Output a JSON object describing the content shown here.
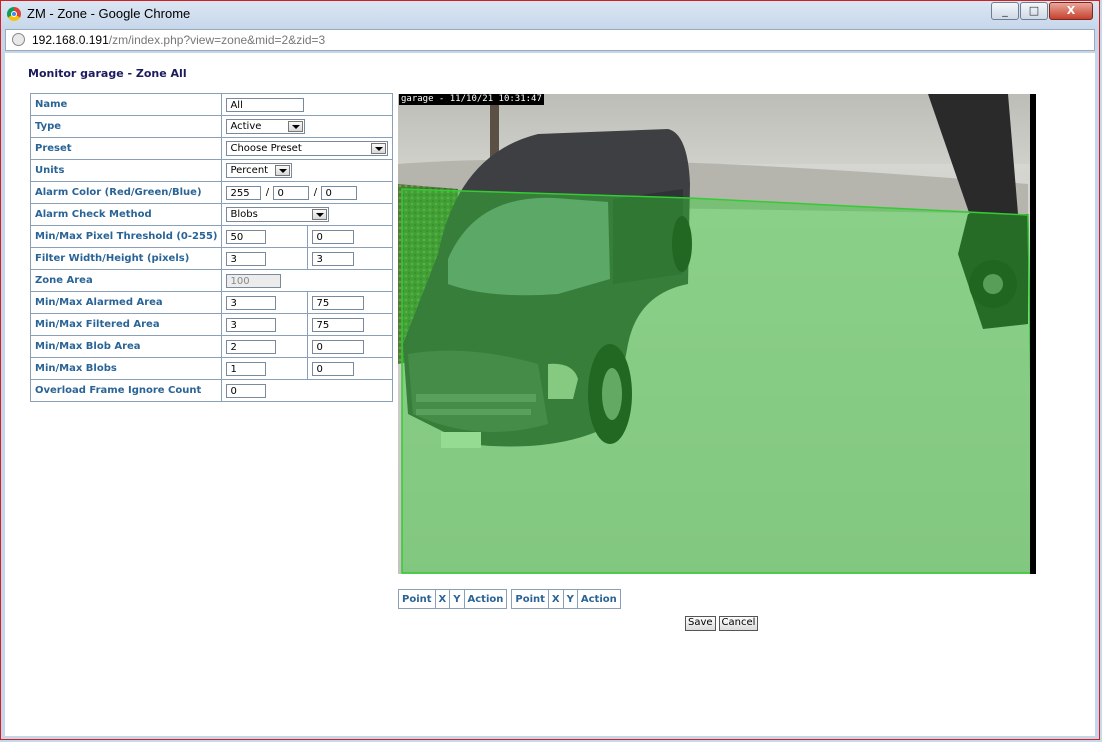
{
  "window": {
    "title": "ZM - Zone - Google Chrome",
    "minimize": "_",
    "maximize": "□",
    "close": "X"
  },
  "address": {
    "host": "192.168.0.191",
    "path": "/zm/index.php?view=zone&mid=2&zid=3"
  },
  "page": {
    "title": "Monitor garage - Zone All"
  },
  "form": {
    "name": {
      "label": "Name",
      "value": "All"
    },
    "type": {
      "label": "Type",
      "value": "Active"
    },
    "preset": {
      "label": "Preset",
      "value": "Choose Preset"
    },
    "units": {
      "label": "Units",
      "value": "Percent"
    },
    "alarm_color": {
      "label": "Alarm Color (Red/Green/Blue)",
      "red": "255",
      "green": "0",
      "blue": "0",
      "sep": "/"
    },
    "check_method": {
      "label": "Alarm Check Method",
      "value": "Blobs"
    },
    "pixel_threshold": {
      "label": "Min/Max Pixel Threshold (0-255)",
      "min": "50",
      "max": "0"
    },
    "filter_size": {
      "label": "Filter Width/Height (pixels)",
      "width": "3",
      "height": "3"
    },
    "zone_area": {
      "label": "Zone Area",
      "value": "100"
    },
    "alarmed_area": {
      "label": "Min/Max Alarmed Area",
      "min": "3",
      "max": "75"
    },
    "filtered_area": {
      "label": "Min/Max Filtered Area",
      "min": "3",
      "max": "75"
    },
    "blob_area": {
      "label": "Min/Max Blob Area",
      "min": "2",
      "max": "0"
    },
    "blobs": {
      "label": "Min/Max Blobs",
      "min": "1",
      "max": "0"
    },
    "overload": {
      "label": "Overload Frame Ignore Count",
      "value": "0"
    }
  },
  "image": {
    "overlay_text": "garage - 11/10/21 10:31:47",
    "zone_color": "#33cc33"
  },
  "points_table": {
    "col_point": "Point",
    "col_x": "X",
    "col_y": "Y",
    "col_action": "Action"
  },
  "buttons": {
    "save": "Save",
    "cancel": "Cancel"
  }
}
